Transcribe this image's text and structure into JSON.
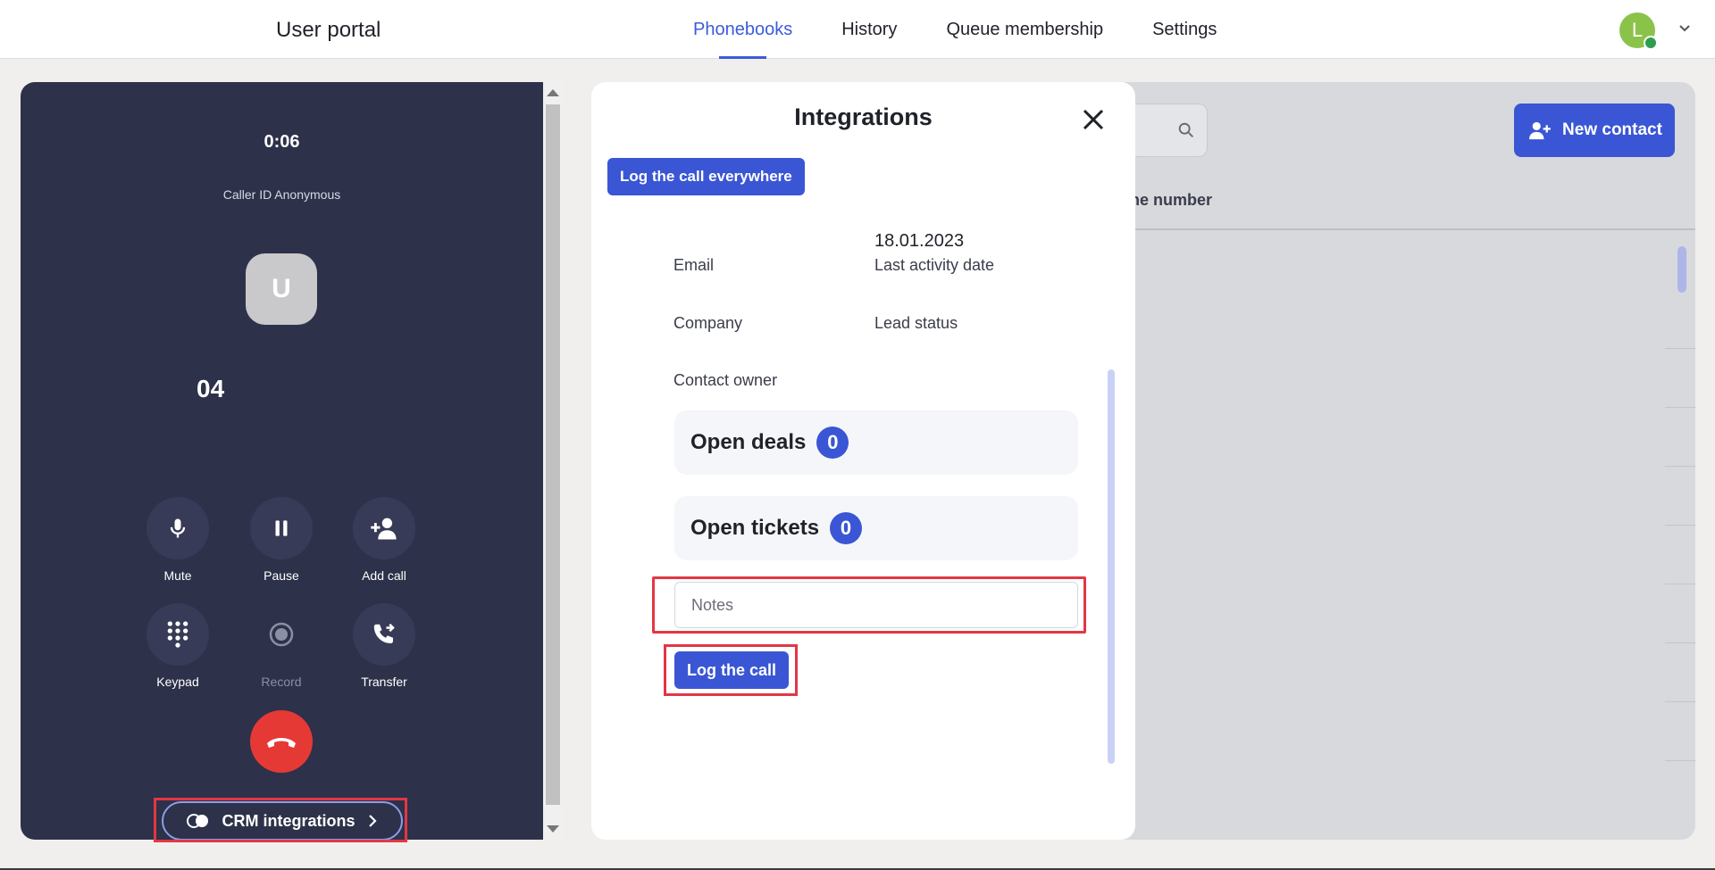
{
  "header": {
    "app_title": "User portal",
    "nav": [
      {
        "label": "Phonebooks",
        "active": true
      },
      {
        "label": "History",
        "active": false
      },
      {
        "label": "Queue membership",
        "active": false
      },
      {
        "label": "Settings",
        "active": false
      }
    ],
    "user_initial": "L"
  },
  "call": {
    "timer": "0:06",
    "caller_id": "Caller ID Anonymous",
    "avatar_initial": "U",
    "number": "04",
    "controls": {
      "mute": "Mute",
      "pause": "Pause",
      "add_call": "Add call",
      "keypad": "Keypad",
      "record": "Record",
      "transfer": "Transfer"
    },
    "crm_button": "CRM integrations"
  },
  "phonebook": {
    "new_contact": "New contact",
    "column_header": "one number"
  },
  "integrations": {
    "title": "Integrations",
    "log_everywhere": "Log the call everywhere",
    "fields": {
      "email_label": "Email",
      "last_activity_value": "18.01.2023",
      "last_activity_label": "Last activity date",
      "company_label": "Company",
      "lead_status_label": "Lead status",
      "contact_owner_label": "Contact owner"
    },
    "open_deals": {
      "label": "Open deals",
      "count": "0"
    },
    "open_tickets": {
      "label": "Open tickets",
      "count": "0"
    },
    "notes_placeholder": "Notes",
    "log_call": "Log the call"
  },
  "colors": {
    "accent": "#3a56d4",
    "panel": "#2d3149",
    "hangup": "#e53935",
    "highlight": "#e23745"
  }
}
